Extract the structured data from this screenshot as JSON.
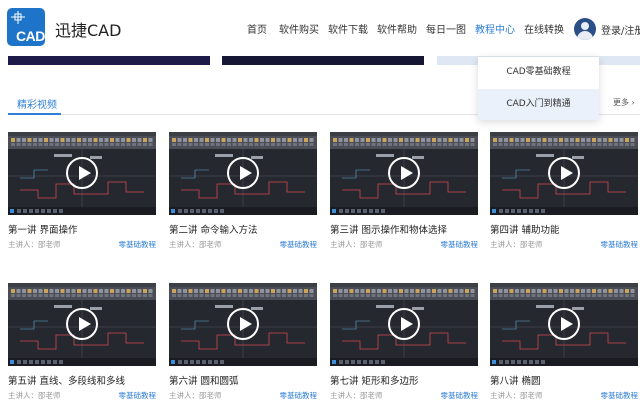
{
  "header": {
    "logo_text": "CAD",
    "brand": "迅捷CAD",
    "nav": [
      {
        "label": "首页",
        "x": 0
      },
      {
        "label": "软件购买",
        "x": 0
      },
      {
        "label": "软件下载",
        "x": 0
      },
      {
        "label": "软件帮助",
        "x": 0
      },
      {
        "label": "每日一图",
        "x": 0
      },
      {
        "label": "教程中心",
        "x": 0
      },
      {
        "label": "在线转换",
        "x": 0
      }
    ],
    "active_nav": "教程中心",
    "login": "登录/注册"
  },
  "dropdown": {
    "items": [
      "CAD零基础教程",
      "CAD入门到精通"
    ],
    "highlighted": "CAD入门到精通"
  },
  "section": {
    "tab": "精彩视频",
    "more": "更多"
  },
  "videos": [
    {
      "title": "第一讲 界面操作",
      "lecturer": "主讲人：邵老师",
      "tag": "零基础教程"
    },
    {
      "title": "第二讲 命令输入方法",
      "lecturer": "主讲人：邵老师",
      "tag": "零基础教程"
    },
    {
      "title": "第三讲 图示操作和物体选择",
      "lecturer": "主讲人：邵老师",
      "tag": "零基础教程"
    },
    {
      "title": "第四讲 辅助功能",
      "lecturer": "主讲人：邵老师",
      "tag": "零基础教程"
    },
    {
      "title": "第五讲 直线、多段线和多线",
      "lecturer": "主讲人：邵老师",
      "tag": "零基础教程"
    },
    {
      "title": "第六讲 圆和圆弧",
      "lecturer": "主讲人：邵老师",
      "tag": "零基础教程"
    },
    {
      "title": "第七讲 矩形和多边形",
      "lecturer": "主讲人：邵老师",
      "tag": "零基础教程"
    },
    {
      "title": "第八讲 椭圆",
      "lecturer": "主讲人：邵老师",
      "tag": "零基础教程"
    }
  ],
  "colors": {
    "accent": "#2f7fd6",
    "logo_bg": "#1e74c8",
    "thumb_bg": "#2b2d33"
  }
}
